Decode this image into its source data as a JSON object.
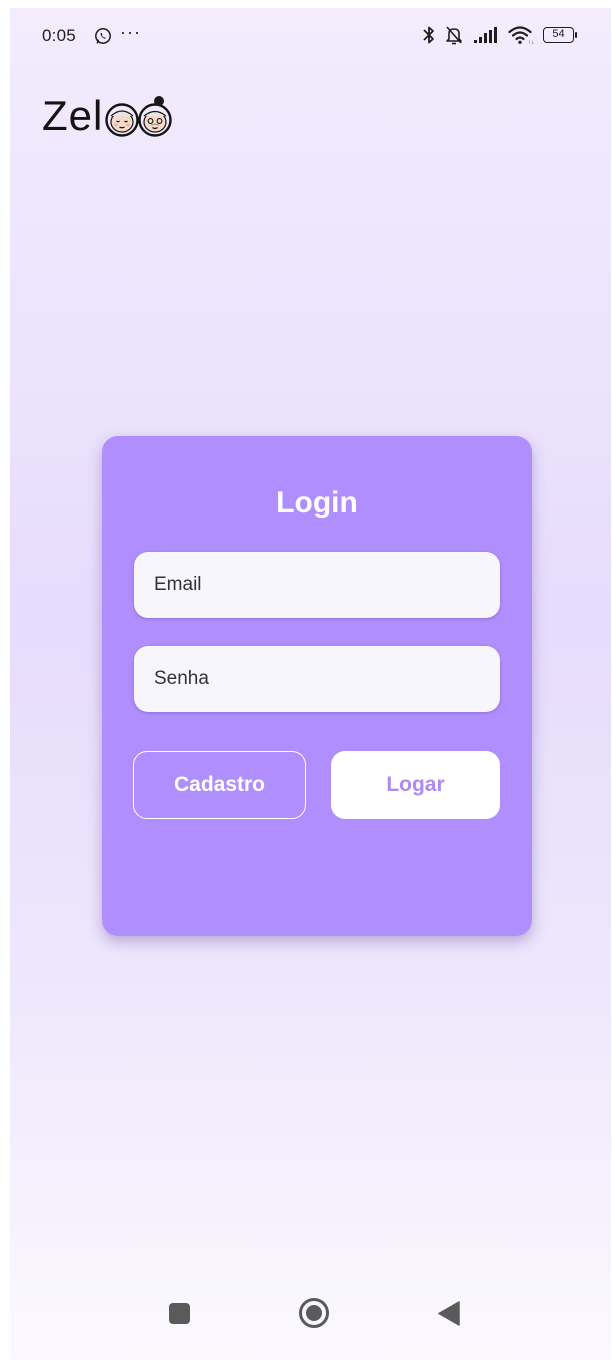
{
  "status_bar": {
    "time": "0:05",
    "overflow": "···",
    "battery_level": "54",
    "icons": [
      "whatsapp-icon",
      "bluetooth-icon",
      "silent-bell-icon",
      "signal-icon",
      "wifi-icon",
      "battery-icon"
    ]
  },
  "app": {
    "logo_text": "Zel",
    "logo_icon": "elderly-faces-logo"
  },
  "login": {
    "title": "Login",
    "email_placeholder": "Email",
    "password_placeholder": "Senha",
    "register_label": "Cadastro",
    "submit_label": "Logar"
  },
  "nav": {
    "icons": [
      "recent-apps-icon",
      "home-icon",
      "back-icon"
    ]
  },
  "colors": {
    "card": "#b08efd",
    "accent_text": "#ad8af4",
    "background_top": "#f2ecfd",
    "background_bottom": "#fbf9fe"
  }
}
